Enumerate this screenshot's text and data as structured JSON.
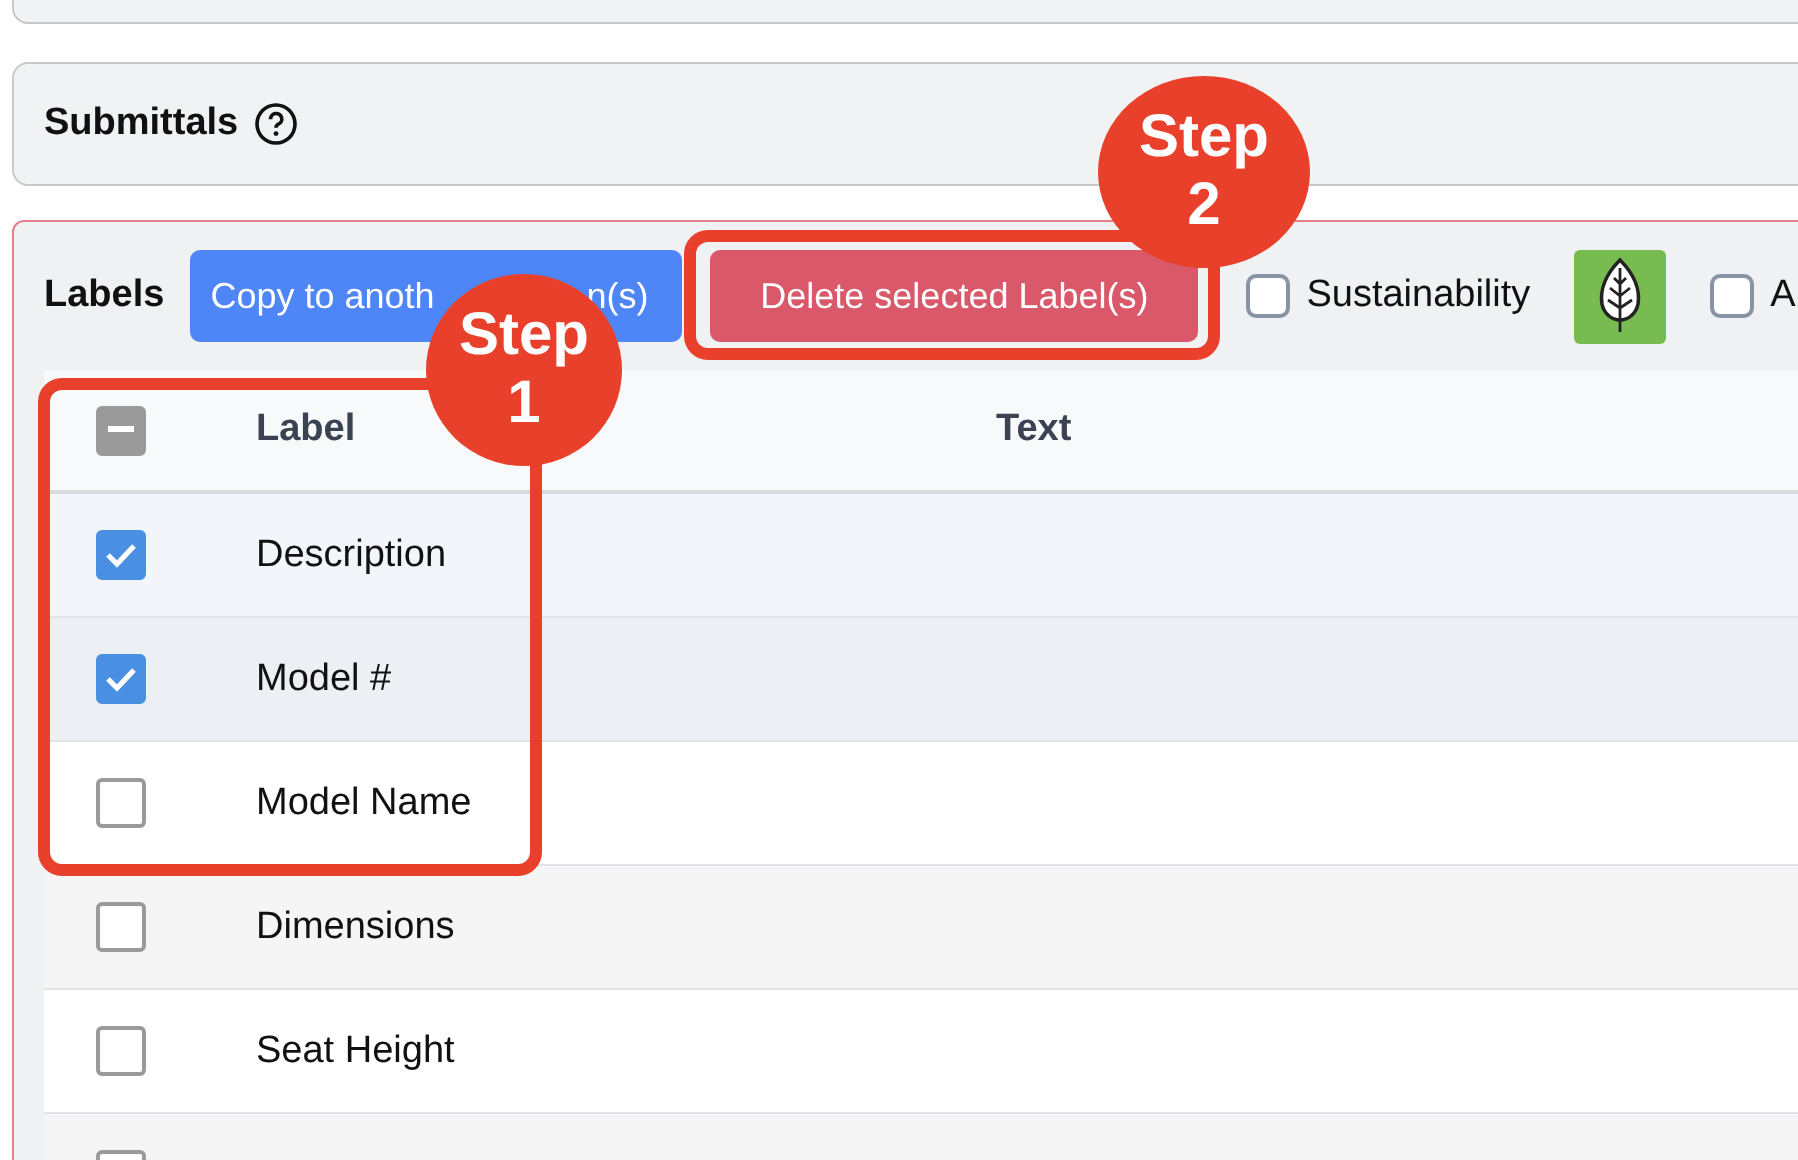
{
  "submittals": {
    "title": "Submittals"
  },
  "labels_panel": {
    "title": "Labels",
    "copy_button": [
      "Copy to anoth",
      "n(s)"
    ],
    "delete_button": "Delete selected Label(s)",
    "filters": [
      {
        "kind": "checkbox",
        "label": "Sustainability",
        "checked": false
      },
      {
        "kind": "leaf"
      },
      {
        "kind": "checkbox",
        "label": "A",
        "checked": false
      }
    ]
  },
  "table": {
    "columns": [
      "Label",
      "Text"
    ],
    "header_partial": true,
    "rows": [
      {
        "label": "Description",
        "checked": true
      },
      {
        "label": "Model #",
        "checked": true
      },
      {
        "label": "Model Name",
        "checked": false
      },
      {
        "label": "Dimensions",
        "checked": false
      },
      {
        "label": "Seat Height",
        "checked": false
      },
      {
        "checked": false
      }
    ]
  },
  "annotations": [
    {
      "title": "Step",
      "number": "1"
    },
    {
      "title": "Step",
      "number": "2"
    }
  ]
}
